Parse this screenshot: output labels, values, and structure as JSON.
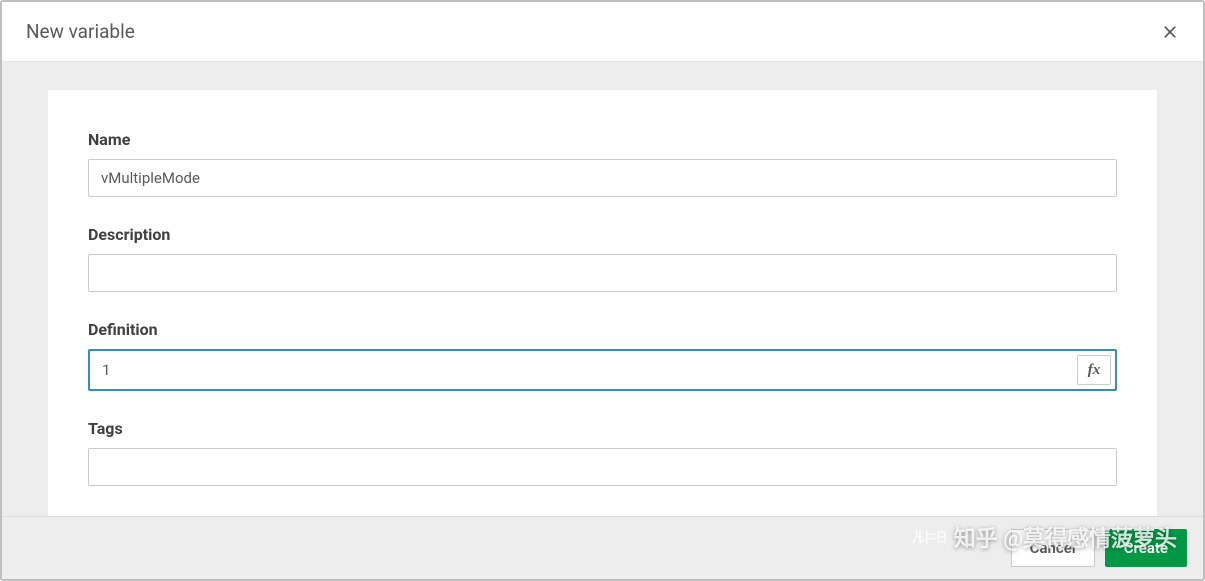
{
  "header": {
    "title": "New variable"
  },
  "form": {
    "name": {
      "label": "Name",
      "value": "vMultipleMode"
    },
    "description": {
      "label": "Description",
      "value": ""
    },
    "definition": {
      "label": "Definition",
      "value": "1"
    },
    "tags": {
      "label": "Tags",
      "value": ""
    }
  },
  "footer": {
    "cancel": "Cancel",
    "create": "Create"
  },
  "icons": {
    "fx": "fx"
  },
  "watermark": "知乎 @莫得感情菠萝头"
}
